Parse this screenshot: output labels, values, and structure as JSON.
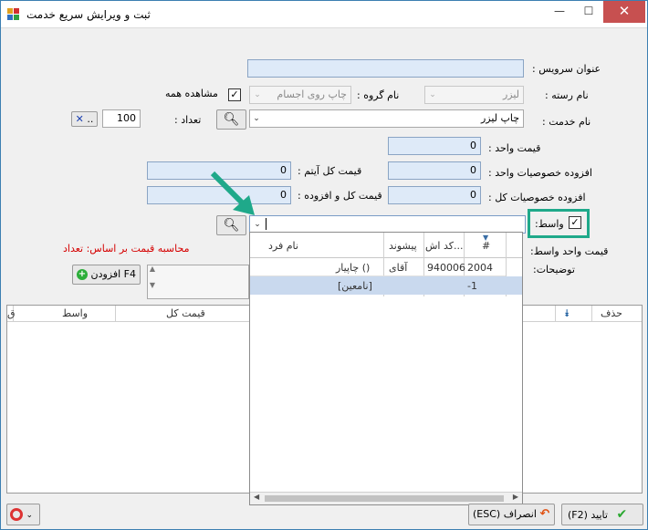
{
  "window": {
    "title": "ثبت و ویرایش سریع خدمت",
    "minimize": "—",
    "maximize": "☐",
    "close": "✕"
  },
  "form": {
    "service_title_label": "عنوان سرويس :",
    "service_title_value": "",
    "category_label": "نام رسته :",
    "category_value": "ليزر",
    "group_label": "نام گروه :",
    "group_value": "چاپ روی اجسام",
    "show_all_label": "مشاهده همه",
    "show_all_checked": "✓",
    "service_name_label": "نام خدمت :",
    "service_name_value": "چاپ ليزر",
    "count_label": "تعداد :",
    "count_value": "100",
    "clear_btn": "..",
    "search_btn": "..",
    "unit_price_label": "قيمت واحد :",
    "unit_price_value": "0",
    "unit_extra_label": "افزوده خصوصيات واحد :",
    "unit_extra_value": "0",
    "item_total_label": "قيمت كل آيتم :",
    "item_total_value": "0",
    "total_extra_label": "افزوده خصوصيات كل :",
    "total_extra_value": "0",
    "total_plus_label": "قيمت كل و افزوده :",
    "total_plus_value": "0",
    "agent_label": "واسط:",
    "agent_checked": "✓",
    "agent_input_value": "",
    "agent_unit_price_label": "قيمت واحد واسط:",
    "calc_note": "محاسبه قيمت بر اساس: تعداد",
    "description_label": "توضيحات:",
    "add_btn": "افزودن F4"
  },
  "grid": {
    "columns": [
      "حذف",
      "قيمت كل",
      "واسط",
      "ق"
    ]
  },
  "popup": {
    "columns": [
      "#",
      "كد اش...",
      "پيشوند",
      "نام فرد"
    ],
    "rows": [
      {
        "num": "2004",
        "code": "940006",
        "prefix": "آقای",
        "name": "چاپيار ()"
      },
      {
        "num": "-1",
        "code": "",
        "prefix": "",
        "name": "[نامعين]"
      }
    ]
  },
  "footer": {
    "confirm": "(F2) تاييد",
    "cancel": "(ESC) انصراف"
  },
  "colors": {
    "highlight": "#1fa98a",
    "field_blue": "#deeaf8",
    "row_selected": "#c9d9ee",
    "red_note": "#d50000"
  }
}
